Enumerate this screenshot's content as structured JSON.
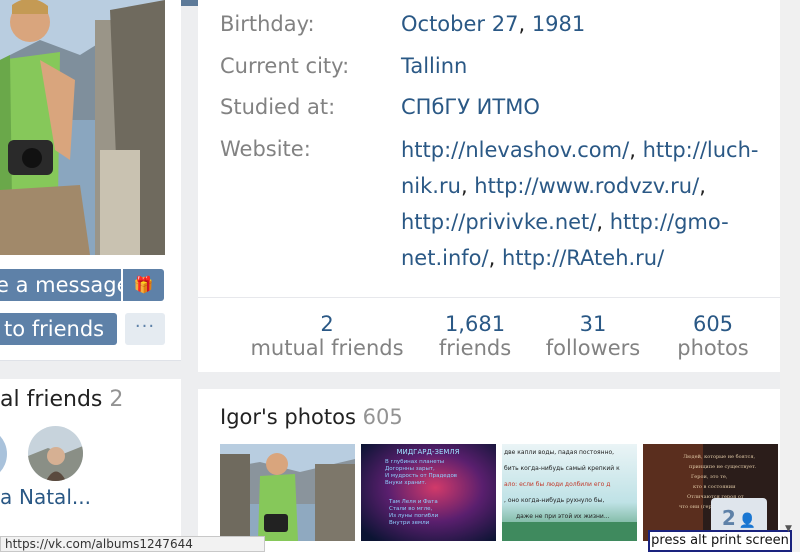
{
  "profile": {
    "rows": [
      {
        "label": "Birthday:",
        "value": "October 27, 1981"
      },
      {
        "label": "Current city:",
        "value": "Tallinn"
      },
      {
        "label": "Studied at:",
        "value": "СПбГУ ИТМО"
      }
    ],
    "website_label": "Website:",
    "websites": [
      "http://nlevashov.com/",
      "http://luch-nik.ru",
      "http://www.rodvzv.ru/",
      "http://privivke.net/",
      "http://gmo-net.info/",
      "http://RAteh.ru/"
    ],
    "birthday_day": "October 27",
    "birthday_year": "1981"
  },
  "stats": [
    {
      "num": "2",
      "caption": "mutual friends"
    },
    {
      "num": "1,681",
      "caption": "friends"
    },
    {
      "num": "31",
      "caption": "followers"
    },
    {
      "num": "605",
      "caption": "photos"
    }
  ],
  "actions": {
    "message": "e a message",
    "add_friend": "to friends",
    "more": "···"
  },
  "friends_block": {
    "title": "al friends",
    "count": "2",
    "names": [
      "a",
      "Natal..."
    ]
  },
  "photos": {
    "title": "Igor's photos",
    "count": "605",
    "poster_title": "МИДГАРД-ЗЕМЛЯ",
    "poster_lines": [
      "В глубинах планеты",
      "Догорнны зарыт,",
      "И мудрость от Прадедов",
      "Внуки хранит.",
      "Там Леля и Фата",
      "Стали во мгле,",
      "Из луны погибли",
      "Внутри земли"
    ],
    "quote_lines": [
      "две капли воды, падая постоянно,",
      "бить когда-нибудь самый крепкий к",
      "ало: если бы люди долбили его д",
      ", оно когда-нибудь рухнуло бы,",
      "даже не при этой их жизни..."
    ],
    "dark_lines": [
      "Людей, которые не боятся,",
      "принципе не существует.",
      "Герои, это те,",
      "кто в состоянии",
      "Отличаются героя от",
      "что они (герои) в состоянии"
    ]
  },
  "chat": {
    "count": "2"
  },
  "statusbar": {
    "url": "https://vk.com/albums1247644"
  },
  "hint": {
    "text": "press alt print screen"
  }
}
